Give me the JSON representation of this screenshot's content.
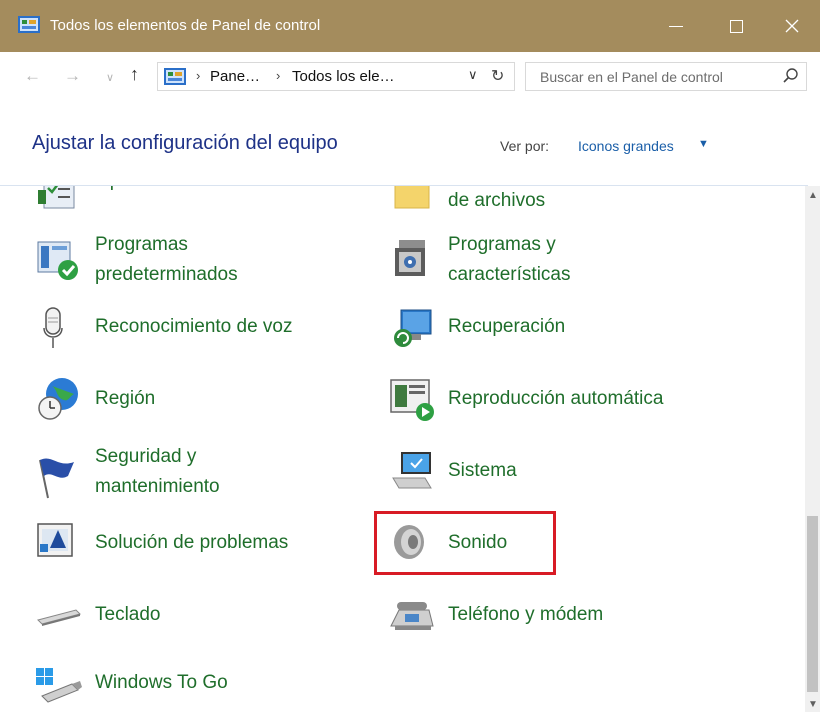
{
  "window": {
    "title": "Todos los elementos de Panel de control",
    "icon": "control-panel-icon",
    "controls": [
      "minimize-icon",
      "maximize-icon",
      "close-icon"
    ]
  },
  "nav": {
    "breadcrumbs": [
      "Pane…",
      "Todos los ele…"
    ],
    "search_placeholder": "Buscar en el Panel de control"
  },
  "header": {
    "title": "Ajustar la configuración del equipo",
    "view_by_label": "Ver por:",
    "view_by_value": "Iconos grandes"
  },
  "items": {
    "opciones_internet": {
      "label": "Opciones de Internet",
      "icon": "internet-options-icon"
    },
    "archivos": {
      "label": "de archivos",
      "icon": "folder-icon"
    },
    "programas_pred": {
      "label_1": "Programas",
      "label_2": "predeterminados",
      "icon": "default-programs-icon"
    },
    "programas_car": {
      "label_1": "Programas y",
      "label_2": "características",
      "icon": "programs-features-icon"
    },
    "voz": {
      "label": "Reconocimiento de voz",
      "icon": "microphone-icon"
    },
    "recuperacion": {
      "label": "Recuperación",
      "icon": "recovery-icon"
    },
    "region": {
      "label": "Región",
      "icon": "globe-clock-icon"
    },
    "reproduccion": {
      "label": "Reproducción automática",
      "icon": "autoplay-icon"
    },
    "seguridad": {
      "label_1": "Seguridad y",
      "label_2": "mantenimiento",
      "icon": "flag-icon"
    },
    "sistema": {
      "label": "Sistema",
      "icon": "computer-icon"
    },
    "solucion": {
      "label": "Solución de problemas",
      "icon": "troubleshoot-icon"
    },
    "sonido": {
      "label": "Sonido",
      "icon": "speaker-icon"
    },
    "teclado": {
      "label": "Teclado",
      "icon": "keyboard-icon"
    },
    "telefono": {
      "label": "Teléfono y módem",
      "icon": "phone-modem-icon"
    },
    "windows_to_go": {
      "label": "Windows To Go",
      "icon": "usb-drive-icon"
    }
  },
  "colors": {
    "titlebar": "#a48c5d",
    "link_green": "#1f6e2b",
    "header_blue": "#1e3287",
    "highlight_red": "#d81b25"
  }
}
